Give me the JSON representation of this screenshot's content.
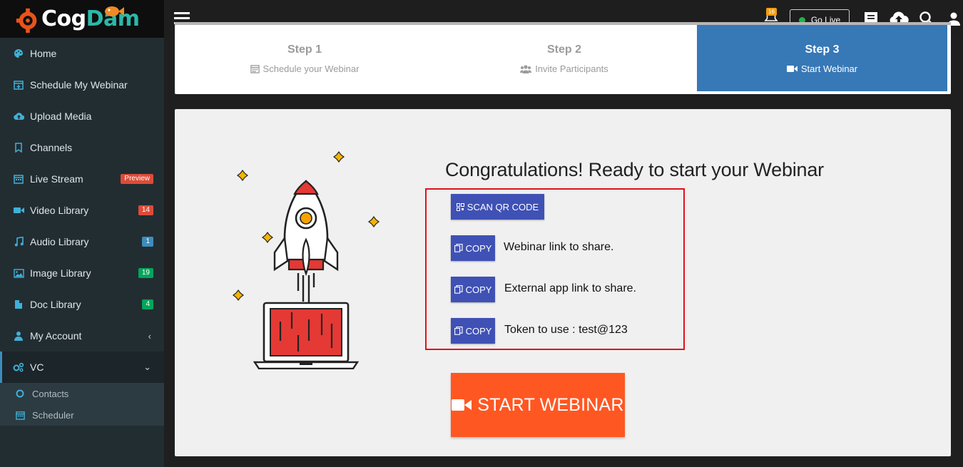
{
  "brand": {
    "part1": "Cog",
    "part2": "Dam"
  },
  "sidebar": {
    "items": [
      {
        "label": "Home",
        "icon": "palette-icon"
      },
      {
        "label": "Schedule My Webinar",
        "icon": "calendar-plus-icon"
      },
      {
        "label": "Upload Media",
        "icon": "cloud-upload-icon"
      },
      {
        "label": "Channels",
        "icon": "bookmark-icon"
      },
      {
        "label": "Live Stream",
        "icon": "calendar-icon",
        "badge": "Preview",
        "badge_color": "#dd4b39"
      },
      {
        "label": "Video Library",
        "icon": "video-icon",
        "badge": "14",
        "badge_color": "#dd4b39"
      },
      {
        "label": "Audio Library",
        "icon": "music-icon",
        "badge": "1",
        "badge_color": "#3c8dbc"
      },
      {
        "label": "Image Library",
        "icon": "image-icon",
        "badge": "19",
        "badge_color": "#00a65a"
      },
      {
        "label": "Doc Library",
        "icon": "document-icon",
        "badge": "4",
        "badge_color": "#00a65a"
      },
      {
        "label": "My Account",
        "icon": "user-icon",
        "chevron": "‹"
      },
      {
        "label": "VC",
        "icon": "gears-icon",
        "chevron": "⌄"
      }
    ],
    "submenu": [
      {
        "label": "Contacts",
        "icon": "circle-icon"
      },
      {
        "label": "Scheduler",
        "icon": "calendar-icon"
      }
    ]
  },
  "topbar": {
    "notification_count": "16",
    "go_live_label": "Go Live"
  },
  "steps": [
    {
      "title": "Step 1",
      "subtitle": "Schedule your Webinar",
      "icon": "calendar-icon"
    },
    {
      "title": "Step 2",
      "subtitle": "Invite Participants",
      "icon": "users-icon"
    },
    {
      "title": "Step 3",
      "subtitle": "Start Webinar",
      "icon": "video-camera-icon"
    }
  ],
  "main": {
    "heading": "Congratulations! Ready to start your Webinar",
    "scan_qr_label": "SCAN QR CODE",
    "copy_label": "COPY",
    "webinar_link_text": "Webinar link to share.",
    "external_link_text": "External app link to share.",
    "token_text": "Token to use : test@123",
    "start_button_label": "START WEBINAR"
  },
  "colors": {
    "sidebar_bg": "#222d32",
    "active_step": "#3778b7",
    "button_blue": "#3f51b5",
    "start_orange": "#ff5722",
    "highlight_red": "#e3101a"
  }
}
